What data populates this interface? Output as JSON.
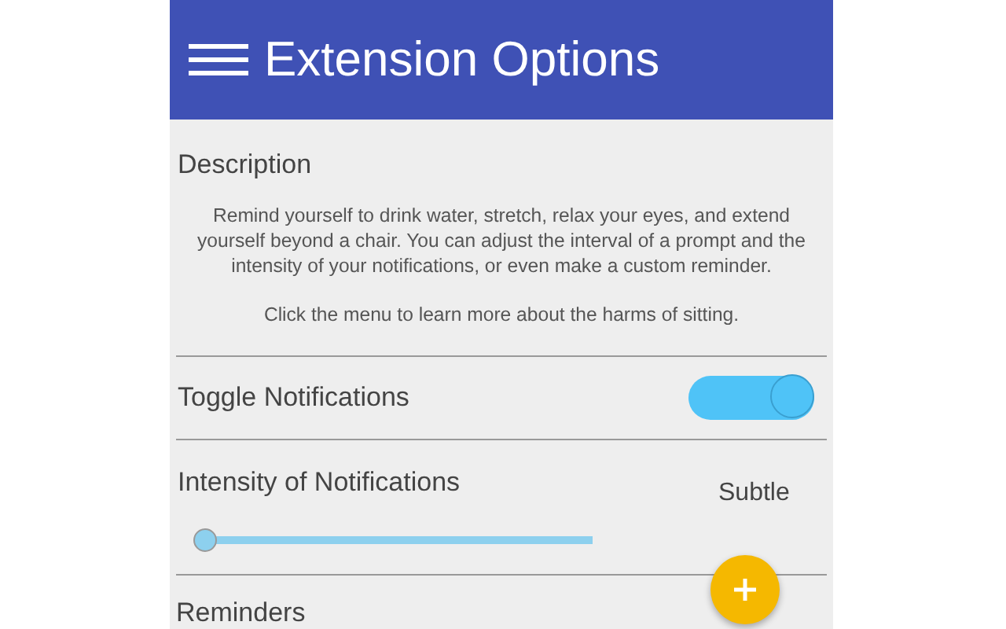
{
  "header": {
    "title": "Extension Options"
  },
  "description": {
    "heading": "Description",
    "paragraphs": [
      "Remind yourself to drink water, stretch, relax your eyes, and extend yourself beyond a chair. You can adjust the interval of a prompt and the intensity of your notifications, or even make a custom reminder.",
      "Click the menu to learn more about the harms of sitting."
    ]
  },
  "settings": [
    {
      "kind": "toggle",
      "label": "Toggle Notifications",
      "on": true
    },
    {
      "kind": "slider",
      "label": "Intensity of Notifications",
      "level": 0,
      "reading": "Subtle"
    },
    {
      "kind": "section",
      "label": "Reminders"
    }
  ],
  "fab": {
    "kind": "add"
  }
}
